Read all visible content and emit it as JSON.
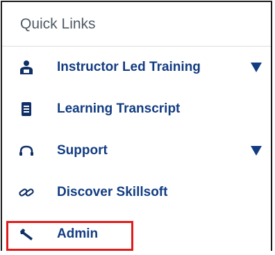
{
  "quick_links": {
    "title": "Quick Links",
    "items": [
      {
        "label": "Instructor Led Training",
        "icon": "instructor-icon",
        "expandable": true
      },
      {
        "label": "Learning Transcript",
        "icon": "transcript-icon",
        "expandable": false
      },
      {
        "label": "Support",
        "icon": "headset-icon",
        "expandable": true
      },
      {
        "label": "Discover Skillsoft",
        "icon": "link-icon",
        "expandable": false
      },
      {
        "label": "Admin",
        "icon": "wrench-icon",
        "expandable": false
      }
    ]
  },
  "colors": {
    "link_text": "#123c82",
    "title_text": "#4f5a64",
    "highlight_border": "#e11b1b",
    "icon": "#0f2f66"
  }
}
